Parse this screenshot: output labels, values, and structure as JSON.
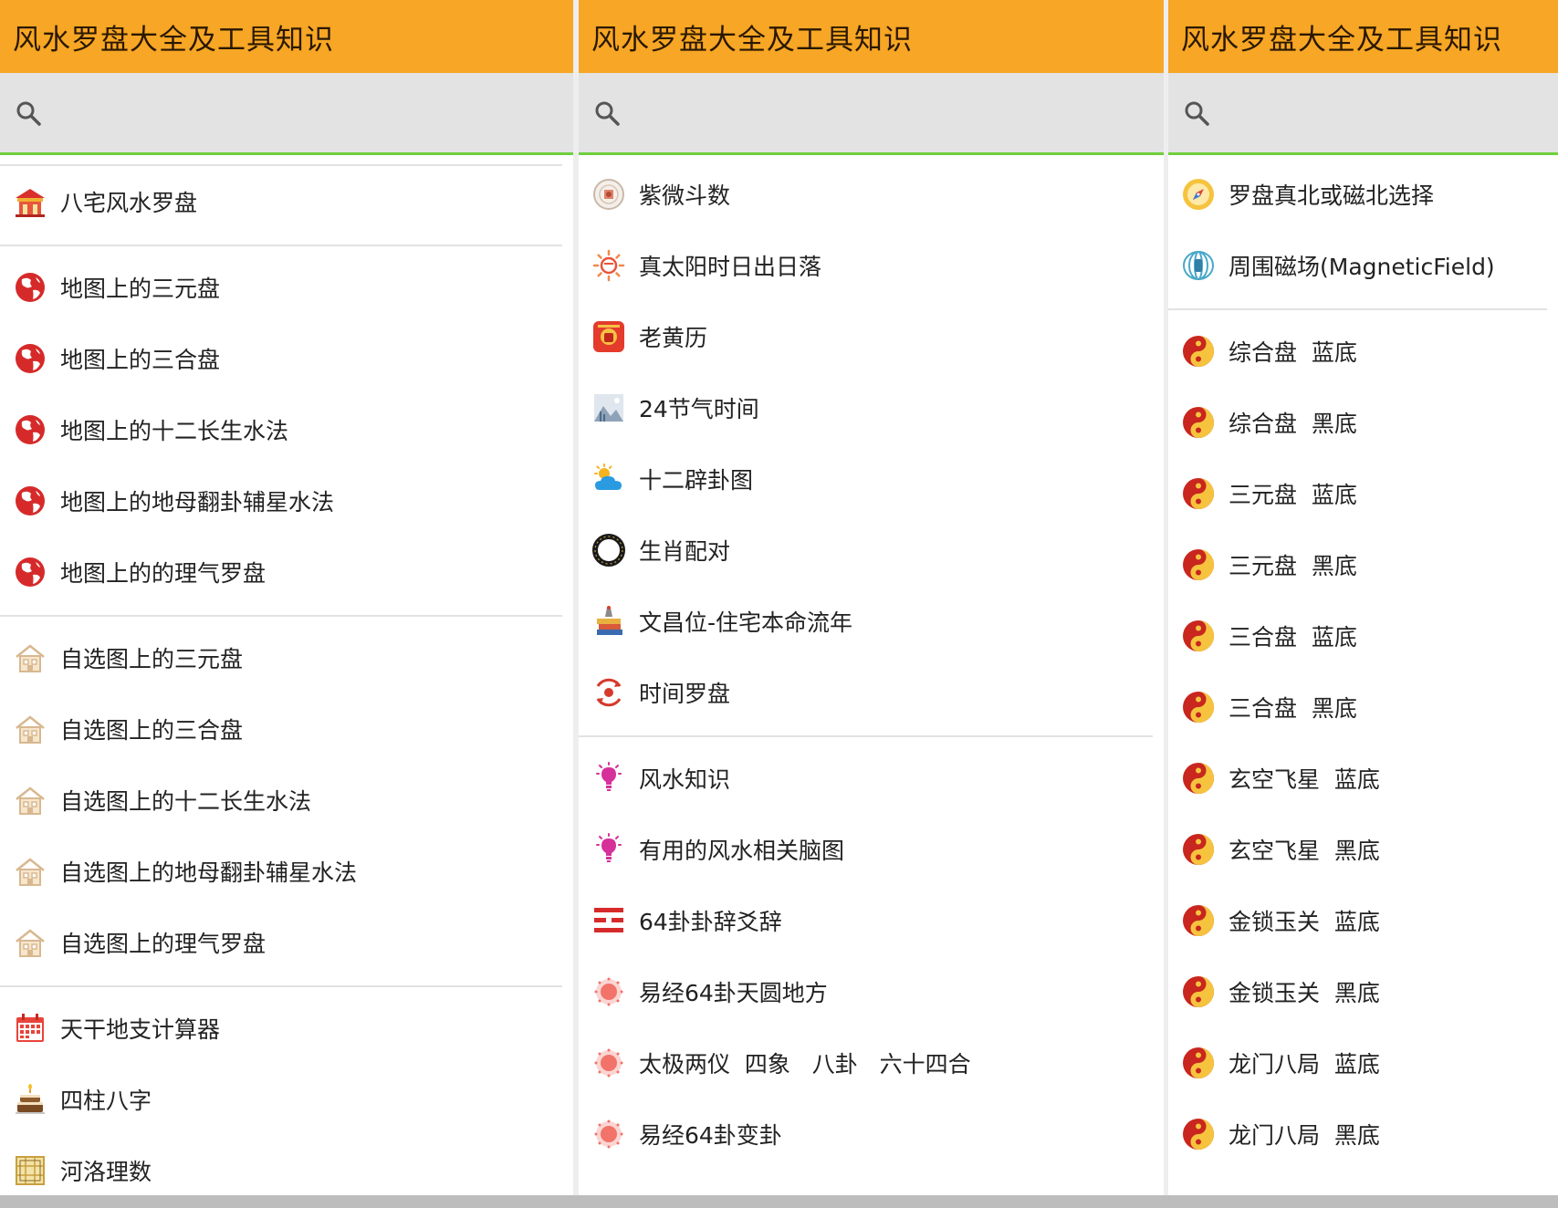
{
  "app_title": "风水罗盘大全及工具知识",
  "search": {
    "placeholder": ""
  },
  "panels": [
    {
      "groups": [
        [
          {
            "label": "八宅风水罗盘",
            "icon": "temple-icon"
          }
        ],
        [
          {
            "label": "地图上的三元盘",
            "icon": "globe-icon"
          },
          {
            "label": "地图上的三合盘",
            "icon": "globe-icon"
          },
          {
            "label": "地图上的十二长生水法",
            "icon": "globe-icon"
          },
          {
            "label": "地图上的地母翻卦辅星水法",
            "icon": "globe-icon"
          },
          {
            "label": "地图上的的理气罗盘",
            "icon": "globe-icon"
          }
        ],
        [
          {
            "label": "自选图上的三元盘",
            "icon": "house-icon"
          },
          {
            "label": "自选图上的三合盘",
            "icon": "house-icon"
          },
          {
            "label": "自选图上的十二长生水法",
            "icon": "house-icon"
          },
          {
            "label": "自选图上的地母翻卦辅星水法",
            "icon": "house-icon"
          },
          {
            "label": "自选图上的理气罗盘",
            "icon": "house-icon"
          }
        ],
        [
          {
            "label": "天干地支计算器",
            "icon": "calendar-icon"
          },
          {
            "label": "四柱八字",
            "icon": "cake-icon"
          },
          {
            "label": "河洛理数",
            "icon": "grid-icon"
          }
        ]
      ]
    },
    {
      "groups": [
        [
          {
            "label": "紫微斗数",
            "icon": "ziwei-icon"
          },
          {
            "label": "真太阳时日出日落",
            "icon": "sun-icon"
          },
          {
            "label": "老黄历",
            "icon": "almanac-icon"
          },
          {
            "label": "24节气时间",
            "icon": "landscape-icon"
          },
          {
            "label": "十二辟卦图",
            "icon": "cloud-sun-icon"
          },
          {
            "label": "生肖配对",
            "icon": "zodiac-ring-icon"
          },
          {
            "label": "文昌位-住宅本命流年",
            "icon": "books-icon"
          },
          {
            "label": "时间罗盘",
            "icon": "refresh-target-icon"
          }
        ],
        [
          {
            "label": "风水知识",
            "icon": "lightbulb-icon"
          },
          {
            "label": "有用的风水相关脑图",
            "icon": "lightbulb-icon"
          },
          {
            "label": "64卦卦辞爻辞",
            "icon": "hexagram-icon"
          },
          {
            "label": "易经64卦天圆地方",
            "icon": "dot-circle-icon"
          },
          {
            "label": "太极两仪  四象   八卦   六十四合",
            "icon": "dot-circle-icon"
          },
          {
            "label": "易经64卦变卦",
            "icon": "dot-circle-icon"
          }
        ]
      ]
    },
    {
      "groups": [
        [
          {
            "label": "罗盘真北或磁北选择",
            "icon": "compass-icon"
          },
          {
            "label": "周围磁场(MagneticField)",
            "icon": "magnet-field-icon"
          }
        ],
        [
          {
            "label": "综合盘  蓝底",
            "icon": "yin-yang-icon"
          },
          {
            "label": "综合盘  黑底",
            "icon": "yin-yang-icon"
          },
          {
            "label": "三元盘  蓝底",
            "icon": "yin-yang-icon"
          },
          {
            "label": "三元盘  黑底",
            "icon": "yin-yang-icon"
          },
          {
            "label": "三合盘  蓝底",
            "icon": "yin-yang-icon"
          },
          {
            "label": "三合盘  黑底",
            "icon": "yin-yang-icon"
          },
          {
            "label": "玄空飞星  蓝底",
            "icon": "yin-yang-icon"
          },
          {
            "label": "玄空飞星  黑底",
            "icon": "yin-yang-icon"
          },
          {
            "label": "金锁玉关  蓝底",
            "icon": "yin-yang-icon"
          },
          {
            "label": "金锁玉关  黑底",
            "icon": "yin-yang-icon"
          },
          {
            "label": "龙门八局  蓝底",
            "icon": "yin-yang-icon"
          },
          {
            "label": "龙门八局  黑底",
            "icon": "yin-yang-icon"
          }
        ]
      ]
    }
  ],
  "colors": {
    "appbar": "#f7a625",
    "search_bg": "#e3e3e3",
    "search_underline": "#6fcf3c"
  }
}
